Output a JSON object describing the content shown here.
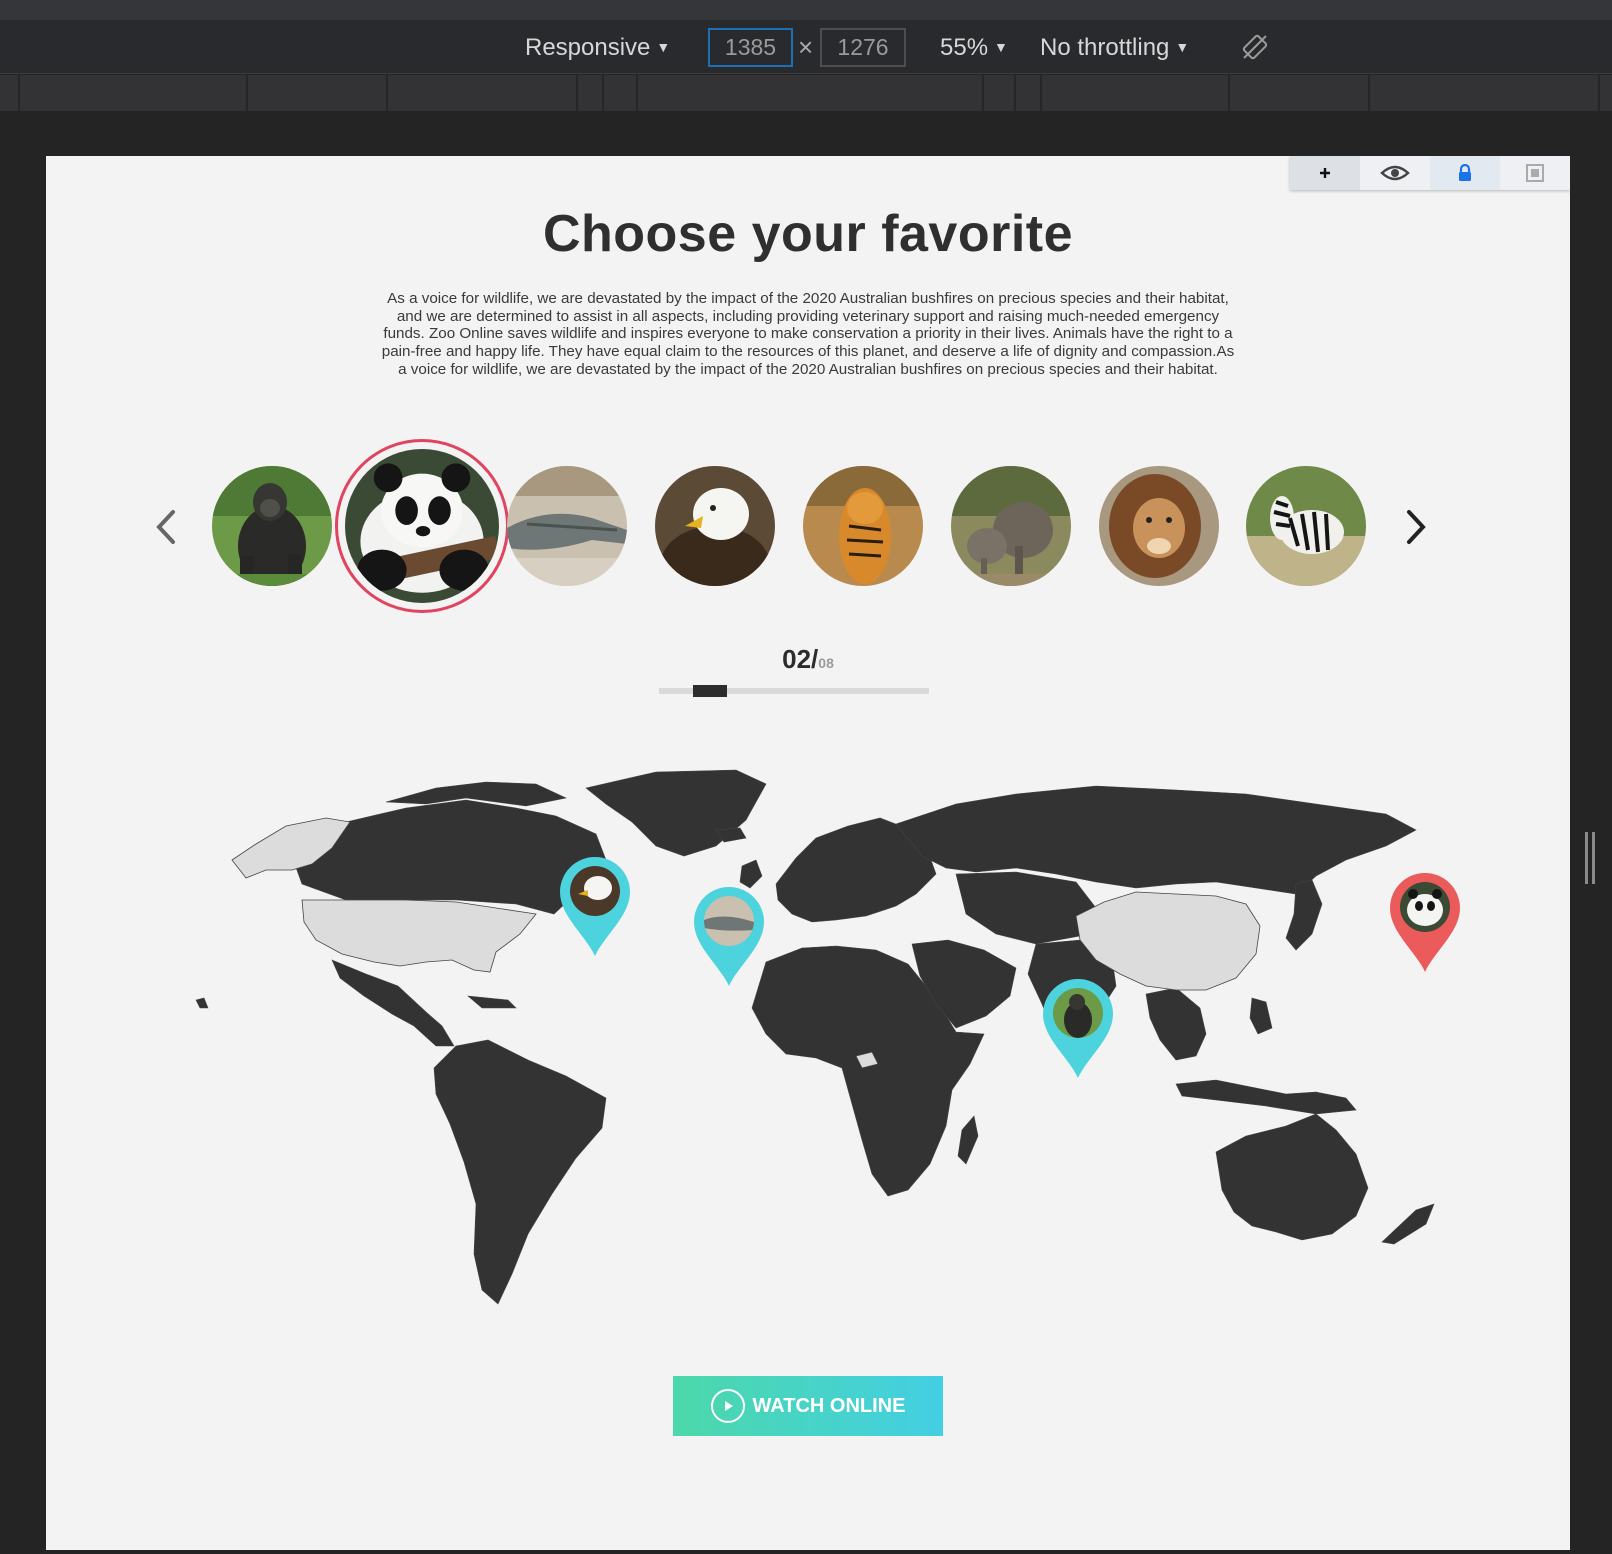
{
  "devtools": {
    "device": "Responsive",
    "width": "1385",
    "height": "1276",
    "times": "×",
    "zoom": "55%",
    "throttling": "No throttling",
    "dropdown_arrow": "▼"
  },
  "page": {
    "title": "Choose your favorite",
    "description": "As a voice for wildlife, we are devastated by the impact of the 2020 Australian bushfires on precious species and their habitat, and we are determined to assist in all aspects, including providing veterinary support and raising much-needed emergency funds. Zoo Online saves wildlife and inspires everyone to make conservation a priority in their lives. Animals have the right to a pain-free and happy life. They have equal claim to the resources of this planet, and deserve a life of dignity and compassion.As a voice for wildlife, we are devastated by the impact of the 2020 Australian bushfires on precious species and their habitat.",
    "animals": [
      "gorilla",
      "panda",
      "alligator",
      "eagle",
      "tiger",
      "elephant",
      "lion",
      "zebra"
    ],
    "selected_index": 2,
    "counter": {
      "current": "02/",
      "total": "08"
    },
    "progress_fraction": 0.125,
    "map_highlighted_regions": [
      "alaska",
      "usa",
      "china"
    ],
    "pins": [
      {
        "animal": "eagle",
        "color": "#4dd3de"
      },
      {
        "animal": "alligator",
        "color": "#4dd3de"
      },
      {
        "animal": "gorilla",
        "color": "#4dd3de"
      },
      {
        "animal": "panda",
        "color": "#ec5b5b"
      }
    ],
    "watch_button": "WATCH ONLINE"
  },
  "colors": {
    "accent_teal": "#4dd3de",
    "accent_red": "#e0445f",
    "pin_red": "#ec5b5b",
    "land_dark": "#333333",
    "land_light": "#dcdcdc"
  }
}
